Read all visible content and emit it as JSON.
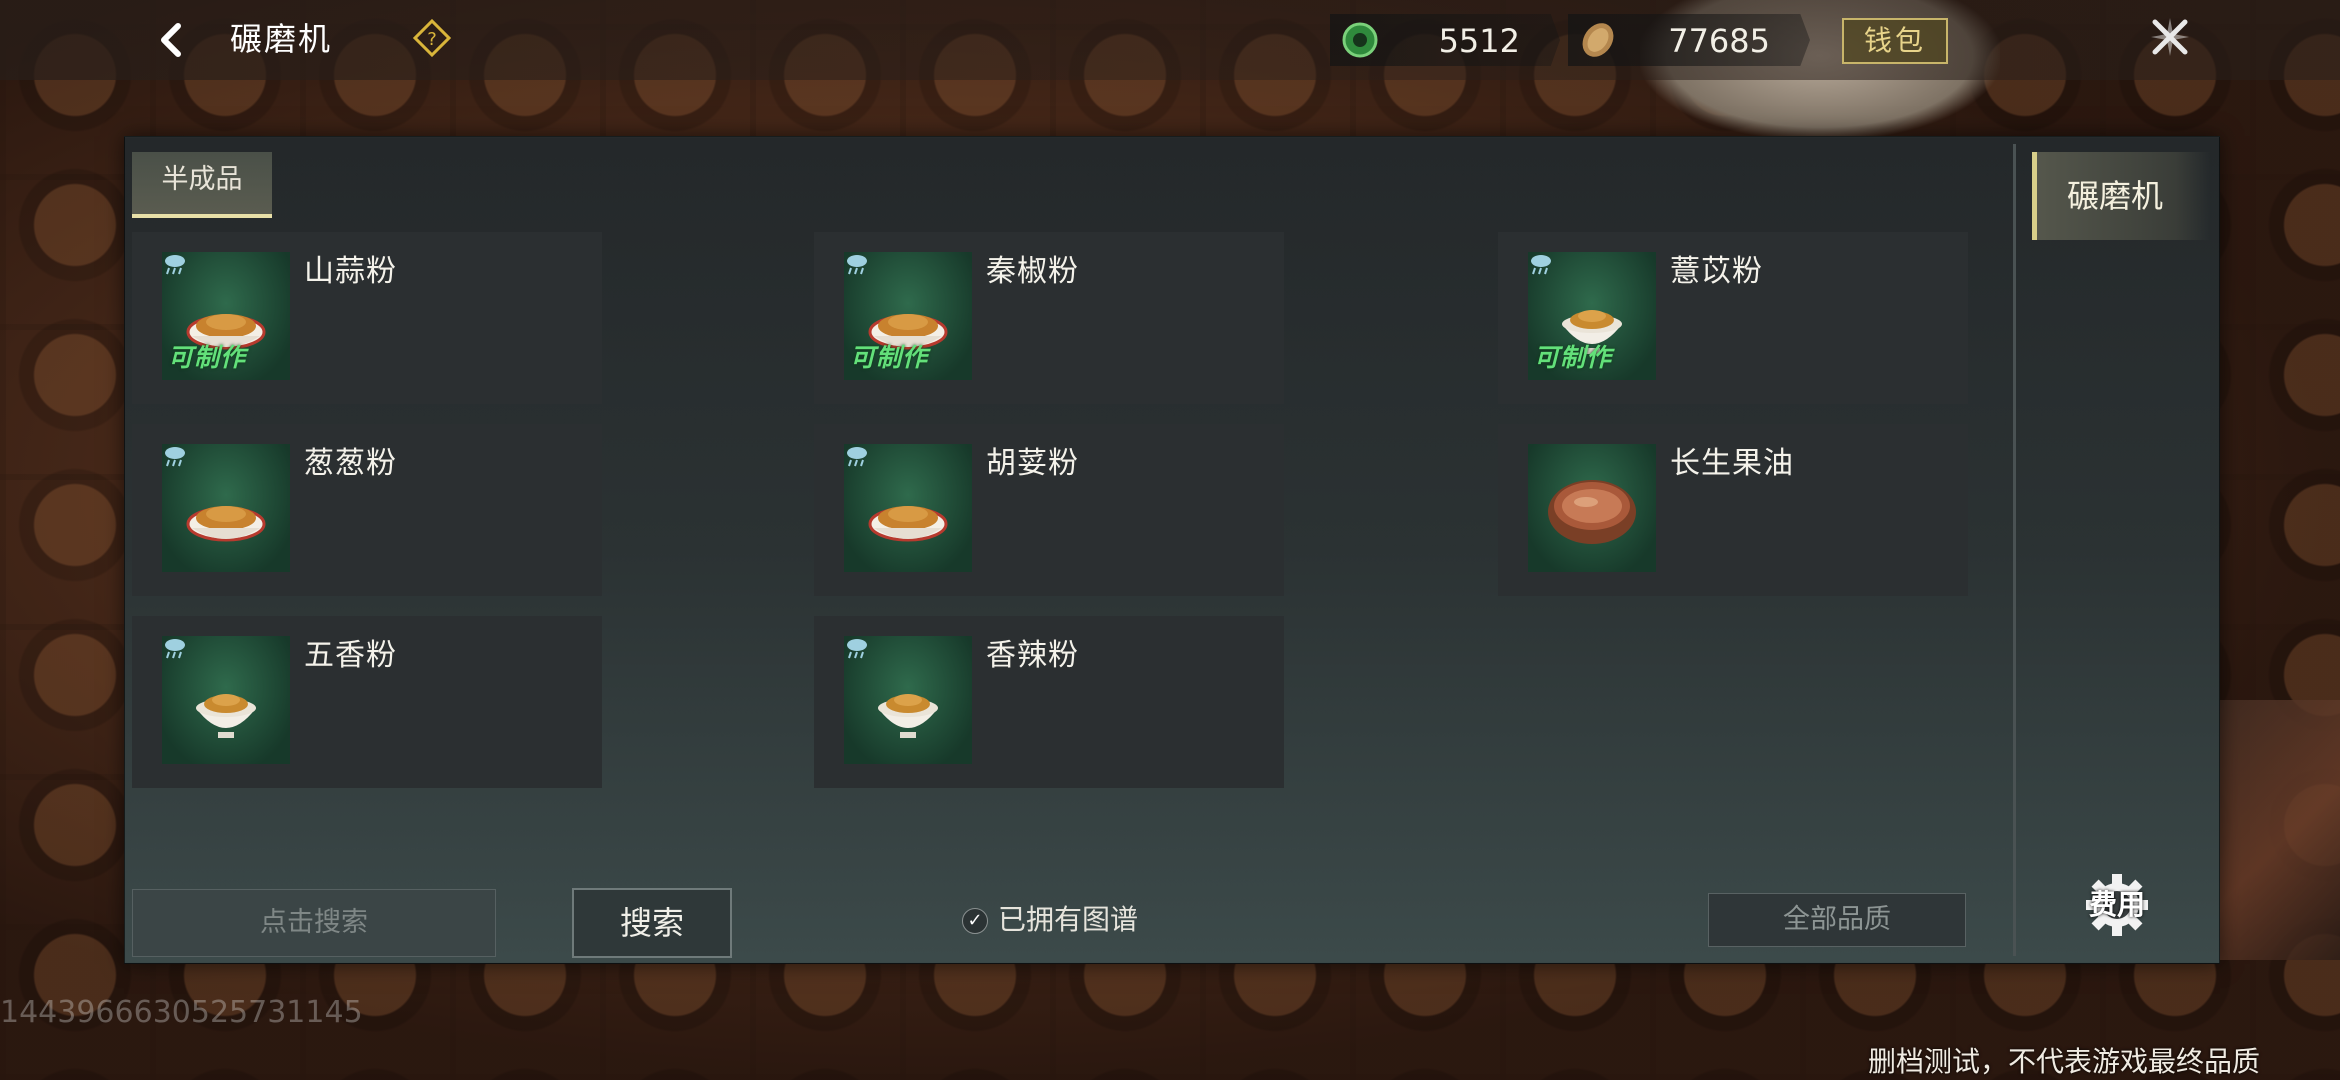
{
  "topbar": {
    "title": "碾磨机",
    "currency1_value": "5512",
    "currency1_icon": "jade-coin-icon",
    "currency2_value": "77685",
    "currency2_icon": "copper-coin-icon",
    "wallet_label": "钱包"
  },
  "tabs": {
    "semi_finished": "半成品"
  },
  "recipes": [
    {
      "name": "山蒜粉",
      "craftable_label": "可制作",
      "craftable": true,
      "bowl": "red-rim"
    },
    {
      "name": "秦椒粉",
      "craftable_label": "可制作",
      "craftable": true,
      "bowl": "red-rim"
    },
    {
      "name": "薏苡粉",
      "craftable_label": "可制作",
      "craftable": true,
      "bowl": "white"
    },
    {
      "name": "葱葱粉",
      "craftable_label": "",
      "craftable": false,
      "bowl": "red-rim"
    },
    {
      "name": "胡荽粉",
      "craftable_label": "",
      "craftable": false,
      "bowl": "red-rim"
    },
    {
      "name": "长生果油",
      "craftable_label": "",
      "craftable": false,
      "bowl": "wood"
    },
    {
      "name": "五香粉",
      "craftable_label": "",
      "craftable": false,
      "bowl": "white"
    },
    {
      "name": "香辣粉",
      "craftable_label": "",
      "craftable": false,
      "bowl": "white"
    }
  ],
  "bottom": {
    "search_placeholder": "点击搜索",
    "search_button": "搜索",
    "owned_filter_label": "已拥有图谱",
    "quality_filter": "全部品质"
  },
  "side": {
    "machine_tab": "碾磨机",
    "fee_label": "费用"
  },
  "footer": {
    "uid": "1443966630525731145",
    "disclaimer": "删档测试，不代表游戏最终品质"
  },
  "colors": {
    "craftable_green": "#63e07a",
    "accent_gold": "#d8cf8a"
  }
}
